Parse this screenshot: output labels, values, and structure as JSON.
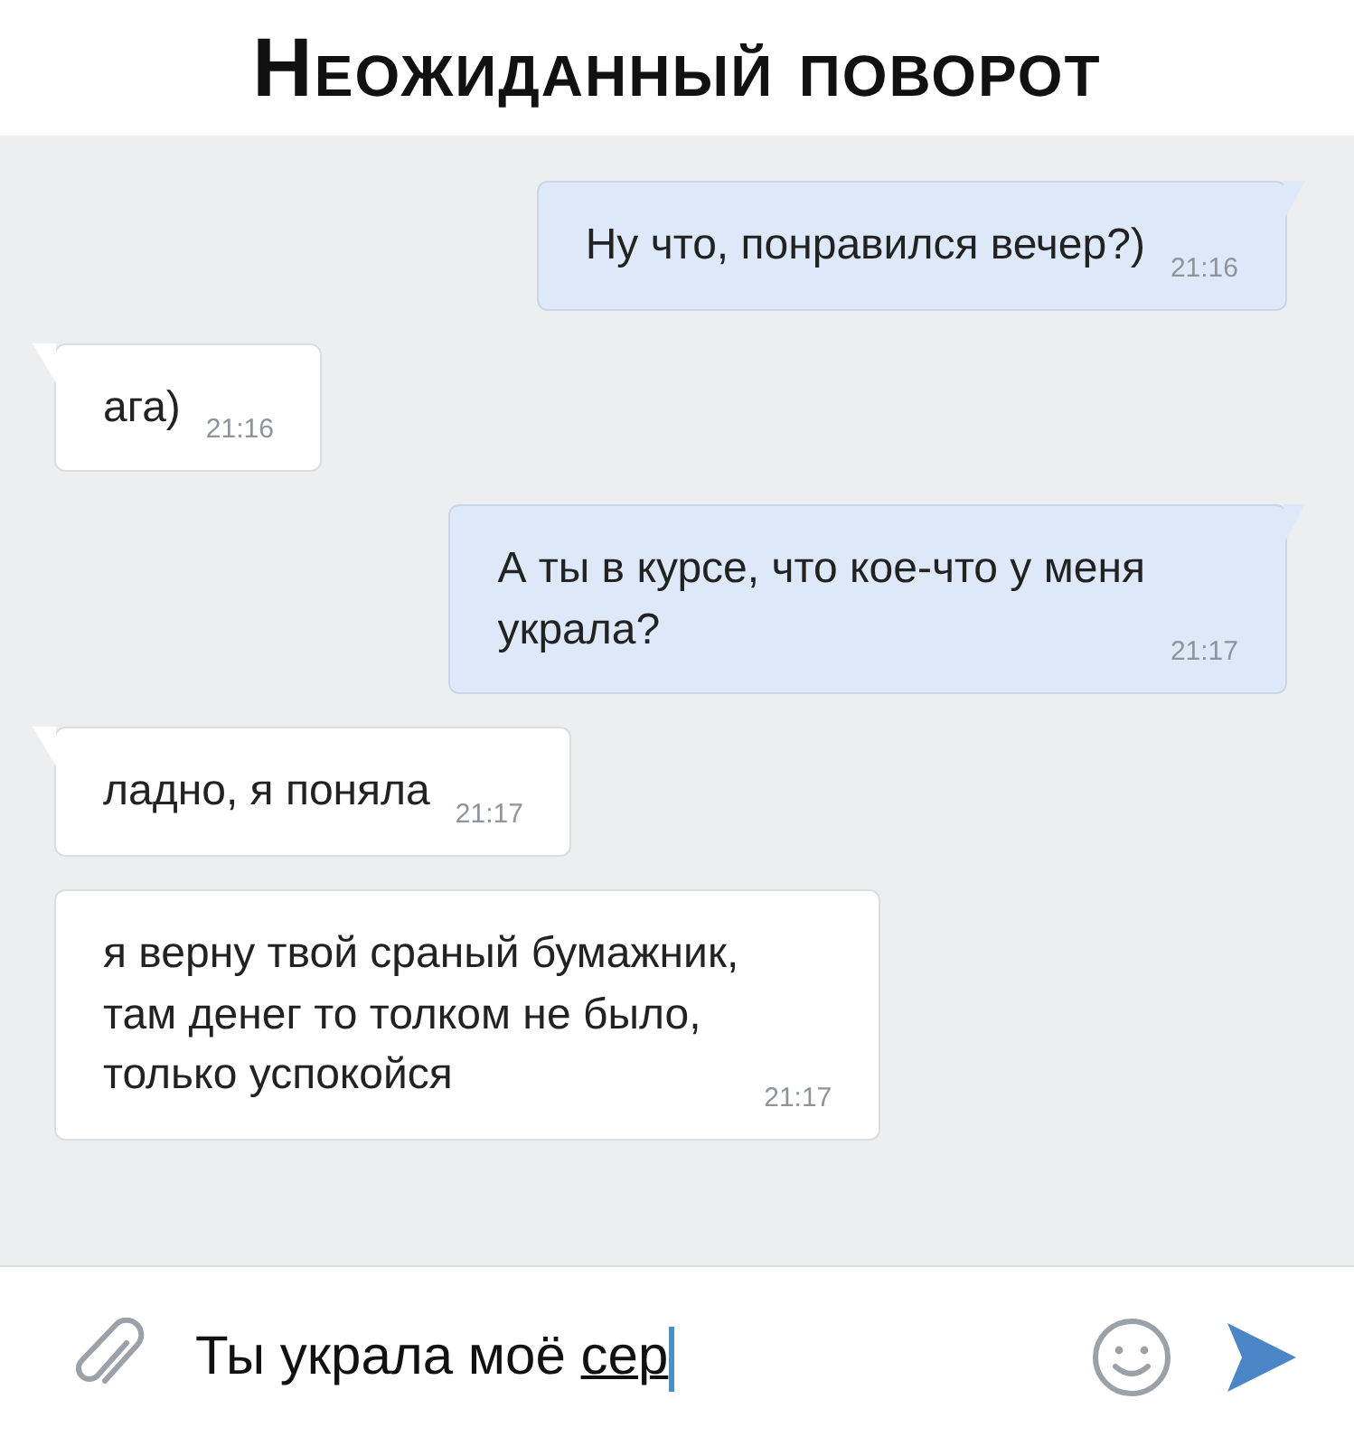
{
  "caption": "Неожиданный поворот",
  "messages": [
    {
      "kind": "outgoing",
      "tail": true,
      "text": "Ну что, понравился вечер?)",
      "time": "21:16"
    },
    {
      "kind": "incoming",
      "tail": true,
      "text": "ага)",
      "time": "21:16"
    },
    {
      "kind": "outgoing",
      "tail": true,
      "text": "А ты в курсе, что кое-что у меня\nукрала?",
      "time": "21:17"
    },
    {
      "kind": "incoming",
      "tail": true,
      "text": "ладно, я поняла",
      "time": "21:17"
    },
    {
      "kind": "incoming",
      "tail": false,
      "text": "я верну твой сраный бумажник,\nтам денег то толком не было,\nтолько успокойся",
      "time": "21:17"
    }
  ],
  "composer": {
    "text": "Ты украла моё ",
    "composing": "сер"
  }
}
